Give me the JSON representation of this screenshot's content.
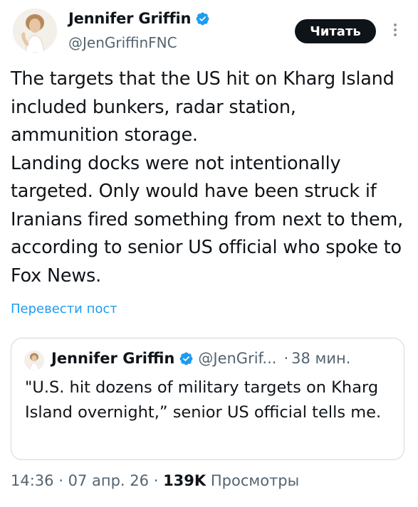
{
  "author": {
    "name": "Jennifer Griffin",
    "handle": "@JenGriffinFNC"
  },
  "follow_button_label": "Читать",
  "tweet": {
    "paragraphs": [
      "The targets that the US hit on Kharg Island included bunkers, radar station, ammunition storage.",
      "Landing docks were not intentionally targeted. Only would have been struck if Iranians fired something from next to them, according to senior US official who spoke to Fox News."
    ],
    "translate_label": "Перевести пост"
  },
  "quoted_tweet": {
    "name": "Jennifer Griffin",
    "handle": "@JenGrif...",
    "separator": "·",
    "time": "38 мин.",
    "text": "\"U.S. hit dozens of military targets on Kharg Island overnight,” senior US official tells me."
  },
  "meta": {
    "time": "14:36",
    "separator": "·",
    "date": "07 апр. 26",
    "views_count": "139K",
    "views_label": "Просмотры"
  },
  "icons": {
    "verified": "verified-badge-icon",
    "more": "more-vertical-icon"
  },
  "colors": {
    "verified_blue": "#1d9bf0",
    "link_blue": "#1d9bf0",
    "secondary_text": "#536471",
    "follow_button_bg": "#0f1419"
  }
}
